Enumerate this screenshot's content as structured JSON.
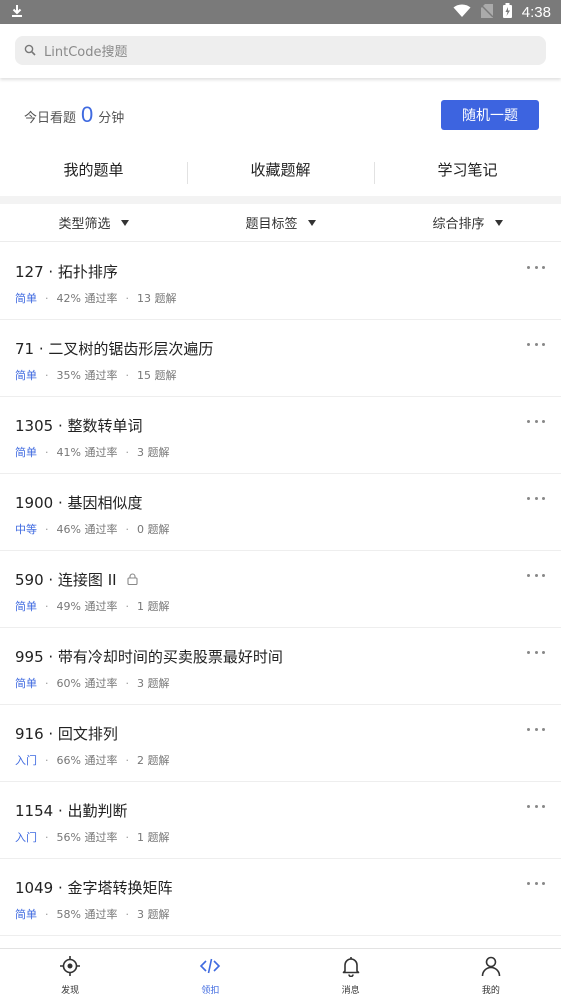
{
  "status_bar": {
    "time": "4:38"
  },
  "search": {
    "placeholder": "LintCode搜题"
  },
  "today": {
    "prefix": "今日看题",
    "count": "0",
    "suffix": "分钟"
  },
  "random_button": "随机一题",
  "tabs": [
    {
      "label": "我的题单"
    },
    {
      "label": "收藏题解"
    },
    {
      "label": "学习笔记"
    }
  ],
  "filters": [
    {
      "label": "类型筛选"
    },
    {
      "label": "题目标签"
    },
    {
      "label": "综合排序"
    }
  ],
  "colors": {
    "accent": "#3d64e0",
    "level_text": "#3f6ae0"
  },
  "problems": [
    {
      "title": "127 · 拓扑排序",
      "locked": false,
      "level": "简单",
      "pass_rate": "42% 通过率",
      "solutions": "13 题解"
    },
    {
      "title": "71 · 二叉树的锯齿形层次遍历",
      "locked": false,
      "level": "简单",
      "pass_rate": "35% 通过率",
      "solutions": "15 题解"
    },
    {
      "title": "1305 · 整数转单词",
      "locked": false,
      "level": "简单",
      "pass_rate": "41% 通过率",
      "solutions": "3 题解"
    },
    {
      "title": "1900 · 基因相似度",
      "locked": false,
      "level": "中等",
      "pass_rate": "46% 通过率",
      "solutions": "0 题解"
    },
    {
      "title": "590 · 连接图 II",
      "locked": true,
      "level": "简单",
      "pass_rate": "49% 通过率",
      "solutions": "1 题解"
    },
    {
      "title": "995 · 带有冷却时间的买卖股票最好时间",
      "locked": false,
      "level": "简单",
      "pass_rate": "60% 通过率",
      "solutions": "3 题解"
    },
    {
      "title": "916 · 回文排列",
      "locked": false,
      "level": "入门",
      "pass_rate": "66% 通过率",
      "solutions": "2 题解"
    },
    {
      "title": "1154 · 出勤判断",
      "locked": false,
      "level": "入门",
      "pass_rate": "56% 通过率",
      "solutions": "1 题解"
    },
    {
      "title": "1049 · 金字塔转换矩阵",
      "locked": false,
      "level": "简单",
      "pass_rate": "58% 通过率",
      "solutions": "3 题解"
    }
  ],
  "bottom_nav": [
    {
      "label": "发现",
      "icon": "discover-icon",
      "active": false
    },
    {
      "label": "领扣",
      "icon": "code-icon",
      "active": true
    },
    {
      "label": "消息",
      "icon": "bell-icon",
      "active": false
    },
    {
      "label": "我的",
      "icon": "user-icon",
      "active": false
    }
  ]
}
